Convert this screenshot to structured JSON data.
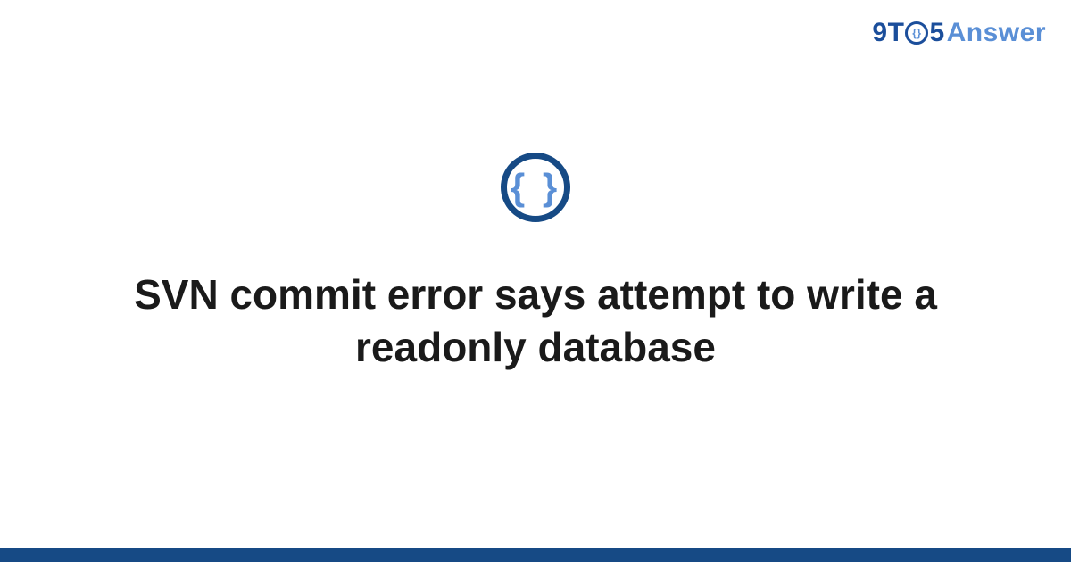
{
  "brand": {
    "nine": "9",
    "t": "T",
    "five": "5",
    "answer": "Answer",
    "mini_braces": "{}"
  },
  "badge": {
    "braces": "{ }"
  },
  "title": "SVN commit error says attempt to write a readonly database",
  "colors": {
    "primary_dark": "#164a85",
    "primary": "#1b4e9b",
    "accent": "#5a8fd6",
    "text": "#1a1a1a"
  }
}
